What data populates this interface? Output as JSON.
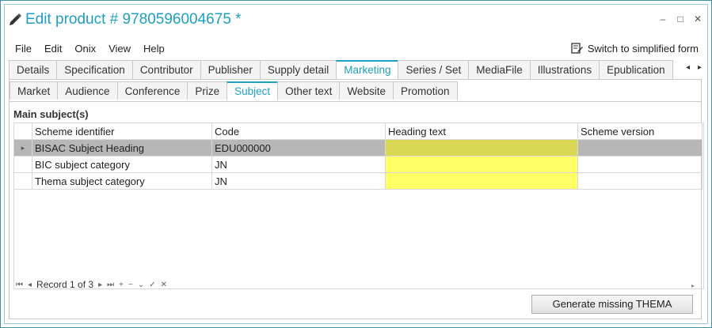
{
  "window": {
    "title": "Edit product # 9780596004675 *",
    "controls": {
      "minimize": "–",
      "maximize": "□",
      "close": "✕"
    }
  },
  "menu": {
    "items": [
      "File",
      "Edit",
      "Onix",
      "View",
      "Help"
    ],
    "simplified_label": "Switch to simplified form"
  },
  "main_tabs": {
    "items": [
      "Details",
      "Specification",
      "Contributor",
      "Publisher",
      "Supply detail",
      "Marketing",
      "Series / Set",
      "MediaFile",
      "Illustrations",
      "Epublication"
    ],
    "active": "Marketing",
    "scroll_left": "◂",
    "scroll_right": "▸"
  },
  "sub_tabs": {
    "items": [
      "Market",
      "Audience",
      "Conference",
      "Prize",
      "Subject",
      "Other text",
      "Website",
      "Promotion"
    ],
    "active": "Subject"
  },
  "section": {
    "title": "Main subject(s)"
  },
  "grid": {
    "columns": [
      "Scheme identifier",
      "Code",
      "Heading text",
      "Scheme version"
    ],
    "rows": [
      {
        "scheme": "BISAC Subject Heading",
        "code": "EDU000000",
        "heading": "",
        "version": ""
      },
      {
        "scheme": "BIC subject category",
        "code": "JN",
        "heading": "",
        "version": ""
      },
      {
        "scheme": "Thema subject category",
        "code": "JN",
        "heading": "",
        "version": ""
      }
    ],
    "selected_indicator": "▸"
  },
  "navigator": {
    "first": "⏮",
    "prev": "◂",
    "record_text": "Record 1 of 3",
    "next": "▸",
    "last": "⏭",
    "add": "+",
    "remove": "−",
    "edit": "⌄",
    "apply": "✓",
    "cancel": "✕"
  },
  "buttons": {
    "generate_thema": "Generate missing THEMA"
  }
}
